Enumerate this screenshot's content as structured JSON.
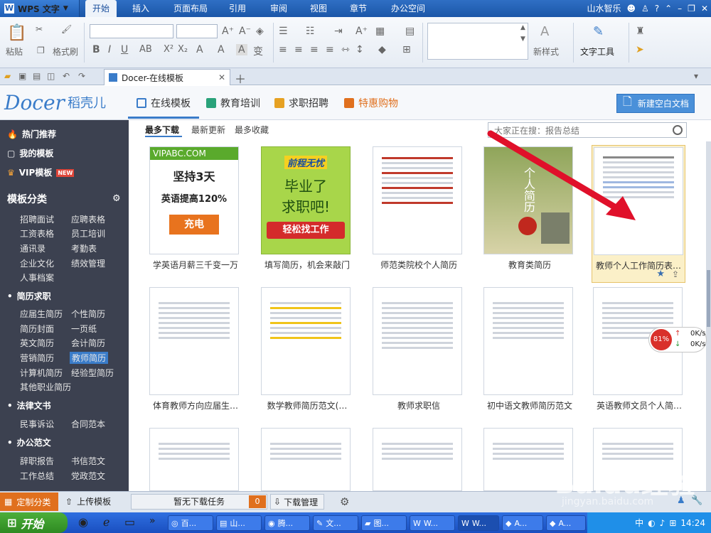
{
  "menubar": {
    "app_title": "WPS 文字",
    "items": [
      "开始",
      "插入",
      "页面布局",
      "引用",
      "审阅",
      "视图",
      "章节",
      "办公空间"
    ],
    "user": "山水智乐",
    "help": "?"
  },
  "ribbon": {
    "paste": "粘贴",
    "format_painter": "格式刷",
    "new_style": "新样式",
    "text_tools": "文字工具"
  },
  "tabbar": {
    "doc_tab": "Docer-在线模板"
  },
  "docer": {
    "brand": "Docer",
    "brand_cn": "稻壳儿",
    "nav": [
      "在线模板",
      "教育培训",
      "求职招聘",
      "特惠购物"
    ],
    "new_blank": "新建空白文档"
  },
  "sidebar": {
    "hot": "热门推荐",
    "mine": "我的模板",
    "vip": "VIP模板",
    "vip_badge": "NEW",
    "category_title": "模板分类",
    "row0": [
      "招聘面试",
      "应聘表格"
    ],
    "row1": [
      "工资表格",
      "员工培训"
    ],
    "row2": [
      "通讯录",
      "考勤表"
    ],
    "row3": [
      "企业文化",
      "绩效管理"
    ],
    "row4": [
      "人事档案"
    ],
    "resume_head": "简历求职",
    "r_row1": [
      "应届生简历",
      "个性简历"
    ],
    "r_row2": [
      "简历封面",
      "一页纸"
    ],
    "r_row3": [
      "英文简历",
      "会计简历"
    ],
    "r_row4": [
      "营销简历",
      "教师简历"
    ],
    "r_row5": [
      "计算机简历",
      "经验型简历"
    ],
    "r_row6": [
      "其他职业简历"
    ],
    "law_head": "法律文书",
    "law_row": [
      "民事诉讼",
      "合同范本"
    ],
    "office_head": "办公范文",
    "o_row1": [
      "辞职报告",
      "书信范文"
    ],
    "o_row2": [
      "工作总结",
      "党政范文"
    ]
  },
  "filters": [
    "最多下载",
    "最新更新",
    "最多收藏"
  ],
  "search": {
    "placeholder": "大家正在搜：报告总结"
  },
  "cards": [
    {
      "caption": "学英语月薪三千变一万",
      "ad_top": "VIPABC.COM",
      "ad_l1": "坚持3天",
      "ad_l2": "英语提高120%",
      "ad_btn": "充电"
    },
    {
      "caption": "填写简历，机会来敲门",
      "ad_top": "前程无忧",
      "ad_l1": "毕业了",
      "ad_l2": "求职吧!",
      "ad_btn": "轻松找工作"
    },
    {
      "caption": "师范类院校个人简历"
    },
    {
      "caption": "教育类简历",
      "cover_title": "个人简历"
    },
    {
      "caption": "教师个人工作简历表…"
    },
    {
      "caption": "体育教师方向应届生…"
    },
    {
      "caption": "数学教师简历范文(…"
    },
    {
      "caption": "教师求职信"
    },
    {
      "caption": "初中语文教师简历范文"
    },
    {
      "caption": "英语教师文员个人简…"
    }
  ],
  "bottombar": {
    "custom": "定制分类",
    "upload": "上传模板",
    "download_status": "暂无下载任务",
    "download_count": "0",
    "download_mgr": "下载管理"
  },
  "speed": {
    "percent": "81%",
    "up": "0K/s",
    "down": "0K/s"
  },
  "taskbar": {
    "start": "开始",
    "tasks": [
      "百...",
      "山...",
      "腾...",
      "文...",
      "图...",
      "W...",
      "W...",
      "A...",
      "A..."
    ],
    "ime": "中",
    "time": "14:24"
  },
  "watermark": {
    "text": "Baidu经验",
    "sub": "jingyan.baidu.com"
  }
}
